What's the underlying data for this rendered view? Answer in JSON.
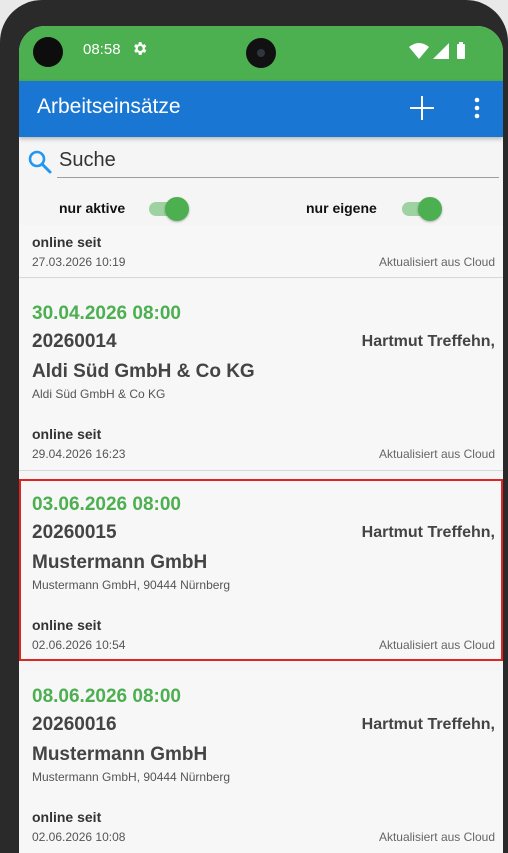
{
  "status_bar": {
    "time": "08:58",
    "settings_icon": "gear-icon",
    "icons": [
      "wifi-icon",
      "signal-icon",
      "battery-icon"
    ]
  },
  "app_bar": {
    "title": "Arbeitseinsätze",
    "add_icon": "plus-icon",
    "menu_icon": "more-vert-icon"
  },
  "search": {
    "placeholder": "Suche",
    "value": ""
  },
  "filters": [
    {
      "label": "nur aktive",
      "on": true
    },
    {
      "label": "nur eigene",
      "on": true
    }
  ],
  "top_card": {
    "online_label": "online seit",
    "online_timestamp": "27.03.2026 10:19",
    "updated": "Aktualisiert aus Cloud"
  },
  "cards": [
    {
      "date": "30.04.2026 08:00",
      "number": "20260014",
      "technician": "Hartmut Treffehn,",
      "company": "Aldi Süd GmbH & Co KG",
      "address": "Aldi Süd GmbH & Co KG",
      "online_label": "online seit",
      "online_timestamp": "29.04.2026 16:23",
      "updated": "Aktualisiert aus Cloud",
      "selected": false
    },
    {
      "date": "03.06.2026 08:00",
      "number": "20260015",
      "technician": "Hartmut Treffehn,",
      "company": "Mustermann GmbH",
      "address": "Mustermann GmbH, 90444 Nürnberg",
      "online_label": "online seit",
      "online_timestamp": "02.06.2026 10:54",
      "updated": "Aktualisiert aus Cloud",
      "selected": true
    },
    {
      "date": "08.06.2026 08:00",
      "number": "20260016",
      "technician": "Hartmut Treffehn,",
      "company": "Mustermann GmbH",
      "address": "Mustermann GmbH, 90444 Nürnberg",
      "online_label": "online seit",
      "online_timestamp": "02.06.2026 10:08",
      "updated": "Aktualisiert aus Cloud",
      "selected": false
    }
  ],
  "colors": {
    "status_bar": "#4caf50",
    "app_bar": "#1976d2",
    "accent_green": "#4caf50",
    "selection_border": "#e02424"
  }
}
